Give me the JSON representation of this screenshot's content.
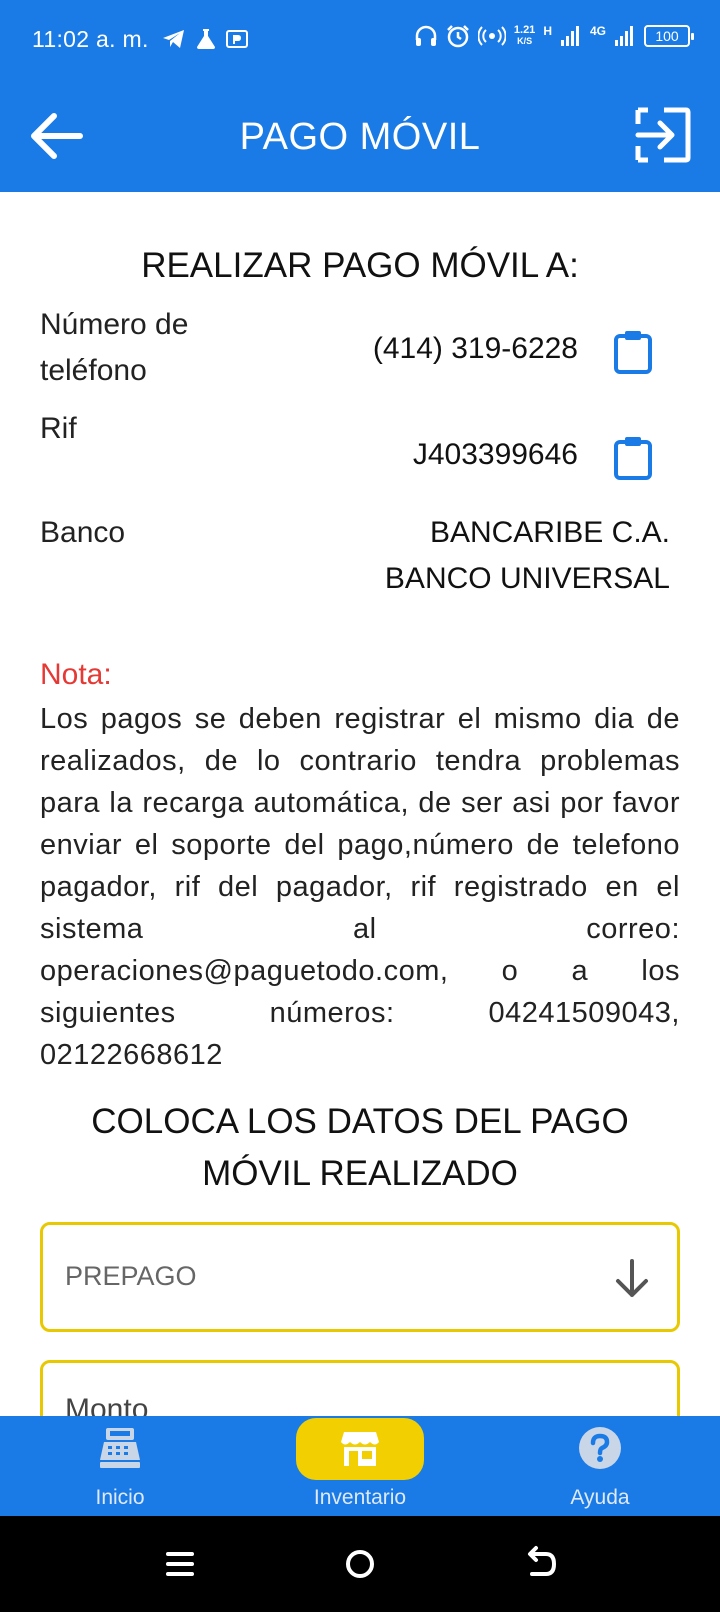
{
  "status_bar": {
    "time": "11:02 a. m.",
    "speed_top": "1.21",
    "speed_bottom": "K/S",
    "network_h": "H",
    "network_4g": "4G",
    "battery": "100"
  },
  "header": {
    "title": "PAGO MÓVIL",
    "back_icon": "arrow-left-icon",
    "exit_icon": "logout-icon"
  },
  "payment_info": {
    "title": "REALIZAR PAGO MÓVIL A:",
    "phone_label_line1": "Número de",
    "phone_label_line2": "teléfono",
    "phone_value": "(414) 319-6228",
    "rif_label": "Rif",
    "rif_value": "J403399646",
    "bank_label": "Banco",
    "bank_value_line1": "BANCARIBE C.A.",
    "bank_value_line2": "BANCO UNIVERSAL"
  },
  "note": {
    "label": "Nota:",
    "text": "Los pagos se deben registrar el mismo dia de realizados, de lo contrario tendra problemas para la recarga automática, de ser asi por favor enviar el soporte del pago,número de telefono pagador, rif del pagador, rif registrado en el sistema al correo: operaciones@paguetodo.com, o a los siguientes números: 04241509043, 02122668612"
  },
  "form": {
    "title_line1": "COLOCA LOS DATOS DEL PAGO",
    "title_line2": "MÓVIL REALIZADO",
    "select_placeholder": "PREPAGO",
    "amount_placeholder": "Monto"
  },
  "bottom_nav": {
    "items": [
      {
        "label": "Inicio",
        "icon": "cash-register-icon"
      },
      {
        "label": "Inventario",
        "icon": "store-icon"
      },
      {
        "label": "Ayuda",
        "icon": "help-icon"
      }
    ]
  },
  "colors": {
    "primary": "#1a7be6",
    "accent": "#f2cf00",
    "note": "#e53935"
  }
}
